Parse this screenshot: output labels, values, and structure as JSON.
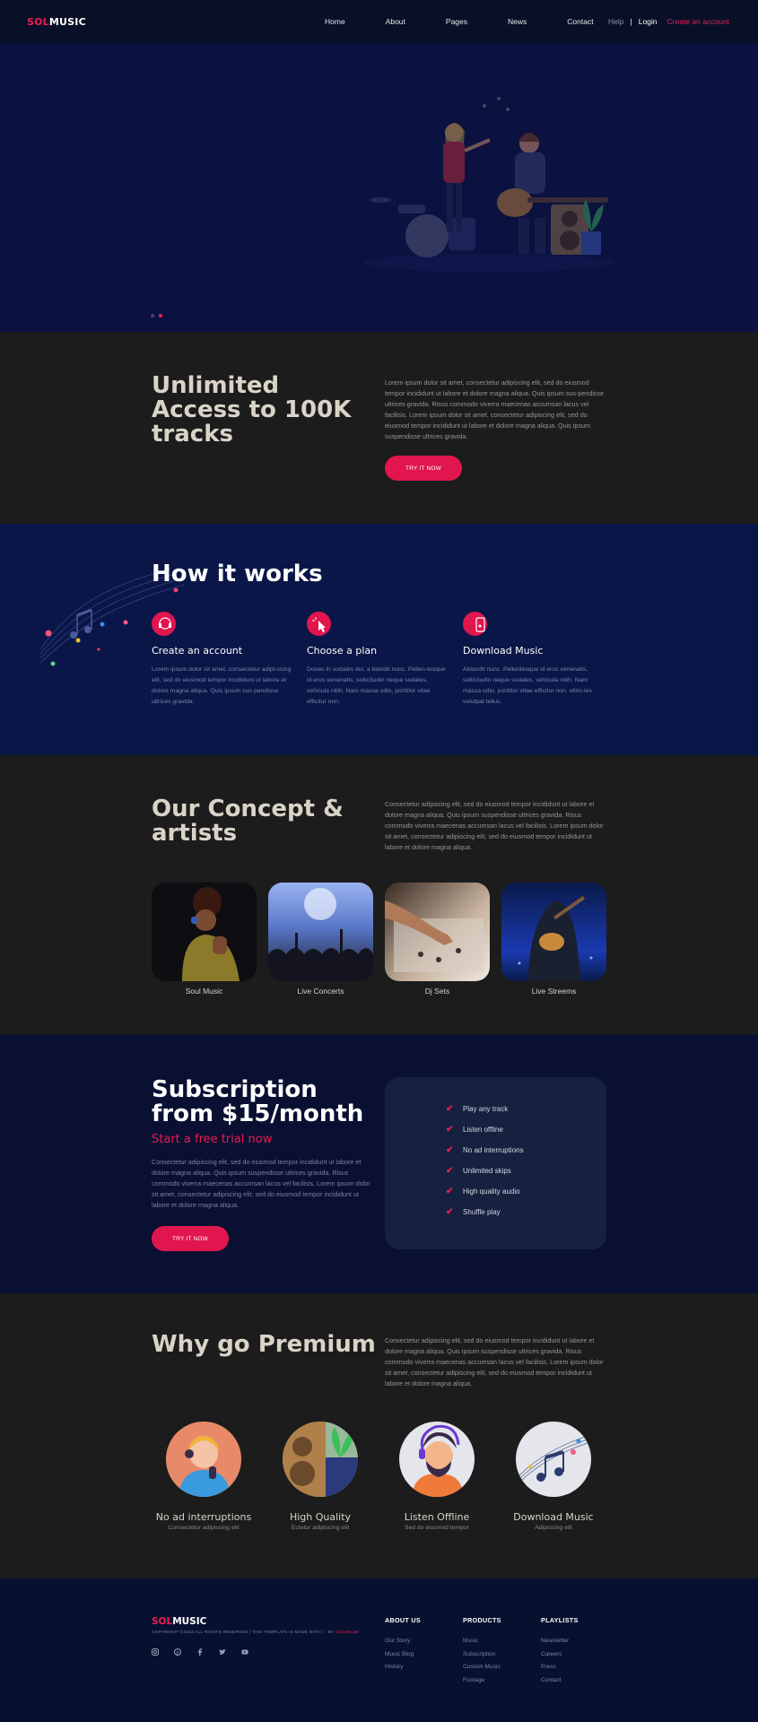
{
  "header": {
    "logo_a": "SOL",
    "logo_b": "MUSIC",
    "nav": [
      "Home",
      "About",
      "Pages",
      "News",
      "Contact"
    ],
    "help": "Help",
    "sep": "|",
    "login": "Login",
    "create": "Create an account"
  },
  "unlimited": {
    "title": "Unlimited Access to 100K tracks",
    "text": "Lorem ipsum dolor sit amet, consectetur adipiscing elit, sed do eiusmod tempor incididunt ut labore et dolore magna aliqua. Quis ipsum sus-pendisse ultrices gravida. Risus commodo viverra maecenas accumsan lacus vel facilisis. Lorem ipsum dolor sit amet, consectetur adipiscing elit, sed do eiusmod tempor incididunt ut labore et dolore magna aliqua. Quis ipsum suspendisse ultrices gravida.",
    "button": "TRY IT NOW"
  },
  "how": {
    "title": "How it works",
    "steps": [
      {
        "title": "Create an account",
        "text": "Lorem ipsum dolor sit amet, consectetur adipi-scing elit, sed do eiusmod tempor incididunt ut labore et dolore magna aliqua. Quis ipsum sus-pendisse ultrices gravida."
      },
      {
        "title": "Choose a plan",
        "text": "Donec in sodales dui, a blandit nunc. Pellen-tesque id eros venenatis, sollicitudin neque sodales, vehicula nibh. Nam massa odio, porttitor vitae efficitur non."
      },
      {
        "title": "Download Music",
        "text": "Ablandit nunc. Pellentesque id eros venenatis, sollicitudin neque sodales, vehicula nibh. Nam massa odio, porttitor vitae efficitur non, ultric-ies volutpat tellus."
      }
    ]
  },
  "concept": {
    "title": "Our Concept & artists",
    "text": "Consectetur adipiscing elit, sed do eiusmod tempor incididunt ut labore et dolore magna aliqua. Quis ipsum suspendisse ultrices gravida. Risus commodo viverra maecenas accumsan lacus vel facilisis. Lorem ipsum dolor sit amet, consectetur adipiscing elit, sed do eiusmod tempor incididunt ut labore et dolore magna aliqua.",
    "cards": [
      "Soul Music",
      "Live Concerts",
      "Dj Sets",
      "Live Streems"
    ]
  },
  "subscription": {
    "title": "Subscription from $15/month",
    "trial": "Start a free trial now",
    "text": "Consectetur adipiscing elit, sed do eiusmod tempor incididunt ut labore et dolore magna aliqua. Quis ipsum suspendisse ultrices gravida. Risus commodo viverra maecenas accumsan lacus vel facilisis. Lorem ipsum dolor sit amet, consectetur adipiscing elit, sed do eiusmod tempor incididunt ut labore et dolore magna aliqua.",
    "button": "TRY IT NOW",
    "features": [
      "Play any track",
      "Listen offline",
      "No ad interruptions",
      "Unlimited skips",
      "High quality audio",
      "Shuffle play"
    ]
  },
  "premium": {
    "title": "Why go Premium",
    "text": "Consectetur adipiscing elit, sed do eiusmod tempor incididunt ut labore et dolore magna aliqua. Quis ipsum suspendisse ultrices gravida. Risus commodo viverra maecenas accumsan lacus vel facilisis. Lorem ipsum dolor sit amet, consectetur adipiscing elit, sed do eiusmod tempor incididunt ut labore et dolore magna aliqua.",
    "items": [
      {
        "title": "No ad interruptions",
        "sub": "Consectetur adipiscing elit"
      },
      {
        "title": "High Quality",
        "sub": "Ectetur adipiscing elit"
      },
      {
        "title": "Listen Offline",
        "sub": "Sed do eiusmod tempor"
      },
      {
        "title": "Download Music",
        "sub": "Adipiscing elit"
      }
    ]
  },
  "footer": {
    "logo_a": "SOL",
    "logo_b": "MUSIC",
    "copyright": "COPYRIGHT ©2024 ALL RIGHTS RESERVED | THIS TEMPLATE IS MADE WITH ♡ BY",
    "copyright_link": "COLORLIB",
    "social": [
      "instagram-icon",
      "pinterest-icon",
      "facebook-icon",
      "twitter-icon",
      "youtube-icon"
    ],
    "columns": [
      {
        "title": "ABOUT US",
        "links": [
          "Our Story",
          "Music Blog",
          "History"
        ]
      },
      {
        "title": "PRODUCTS",
        "links": [
          "Music",
          "Subscription",
          "Custom Music",
          "Footage"
        ]
      },
      {
        "title": "PLAYLISTS",
        "links": [
          "Newsletter",
          "Careers",
          "Press",
          "Contact"
        ]
      }
    ]
  },
  "colors": {
    "accent": "#f01a53",
    "navy": "#0b1648",
    "dark": "#1c1c1c"
  }
}
